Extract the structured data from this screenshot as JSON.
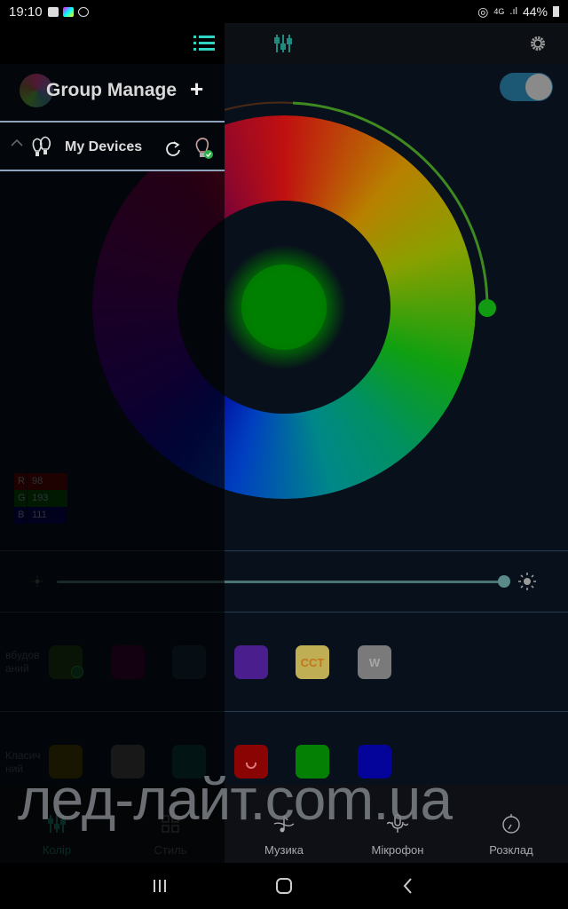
{
  "status_bar": {
    "time": "19:10",
    "network": "4G",
    "battery": "44%"
  },
  "app": {
    "power_on": true,
    "current_color": {
      "r": 98,
      "g": 193,
      "b": 111,
      "selected_hex": "#008000"
    },
    "rgb": [
      {
        "key": "R",
        "value": "98",
        "color": "#5a0606"
      },
      {
        "key": "G",
        "value": "193",
        "color": "#064a06"
      },
      {
        "key": "B",
        "value": "111",
        "color": "#06065a"
      }
    ],
    "brightness_percent": 100,
    "presets": {
      "builtin": {
        "label": "вбудов аний",
        "swatches": [
          {
            "name": "green",
            "color": "#1e3a14",
            "text": "",
            "selected": true
          },
          {
            "name": "magenta",
            "color": "#3a0432",
            "text": ""
          },
          {
            "name": "navy",
            "color": "#16283a",
            "text": ""
          },
          {
            "name": "purple",
            "color": "#4a1e8c",
            "text": ""
          },
          {
            "name": "cct",
            "color": "#bfae54",
            "text": "CCT",
            "text_color": "#c4761c"
          },
          {
            "name": "white",
            "color": "#7a7a7a",
            "text": "W",
            "text_color": "#a8a8a8"
          }
        ]
      },
      "classic": {
        "label": "Класич ний",
        "swatches": [
          {
            "name": "olive",
            "color": "#4a4000",
            "text": ""
          },
          {
            "name": "gray",
            "color": "#4a4a4a",
            "text": ""
          },
          {
            "name": "teal",
            "color": "#083c3a",
            "text": ""
          },
          {
            "name": "red",
            "color": "#8a0404",
            "text": ""
          },
          {
            "name": "green",
            "color": "#048004",
            "text": ""
          },
          {
            "name": "blue",
            "color": "#04049a",
            "text": ""
          }
        ]
      }
    },
    "bottom_nav": [
      {
        "label": "Колір",
        "icon": "sliders-icon",
        "active": true
      },
      {
        "label": "Стиль",
        "icon": "grid-icon",
        "active": false
      },
      {
        "label": "Музика",
        "icon": "music-note-icon",
        "active": false
      },
      {
        "label": "Мікрофон",
        "icon": "microphone-icon",
        "active": false
      },
      {
        "label": "Розклад",
        "icon": "timer-icon",
        "active": false
      }
    ],
    "watermark": "лед-лайт.com.ua"
  },
  "drawer": {
    "title": "Group Manage",
    "add_label": "+",
    "devices_label": "My Devices"
  },
  "colors": {
    "accent": "#2fd4c2",
    "active_nav": "#1e7a70"
  }
}
